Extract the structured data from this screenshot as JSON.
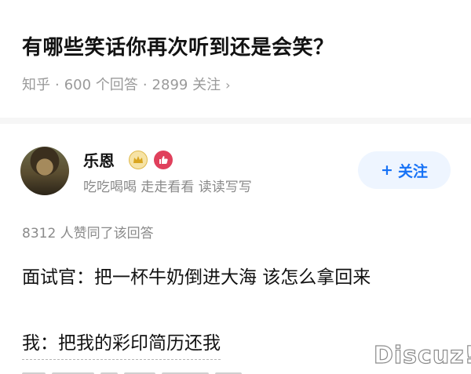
{
  "question": {
    "title": "有哪些笑话你再次听到还是会笑？",
    "source": "知乎",
    "answers": "600 个回答",
    "followers": "2899 关注",
    "chevron_icon": "chevron-right-icon"
  },
  "author": {
    "name": "乐恩",
    "bio": "吃吃喝喝 走走看看 读读写写",
    "badges": [
      "crown-badge-icon",
      "thumbs-up-badge-icon"
    ],
    "follow_label": "关注",
    "follow_icon": "plus-icon"
  },
  "answer": {
    "votes": "8312 人赞同了该回答",
    "line1": "面试官：把一杯牛奶倒进大海 该怎么拿回来",
    "line2": "我：把我的彩印简历还我"
  },
  "watermark": "Discuz!",
  "colors": {
    "accent": "#1772f6",
    "follow_bg": "#eef5ff",
    "muted_text": "#8a8a8a",
    "crown_badge": "#e0b94a",
    "like_badge": "#e0405c"
  }
}
